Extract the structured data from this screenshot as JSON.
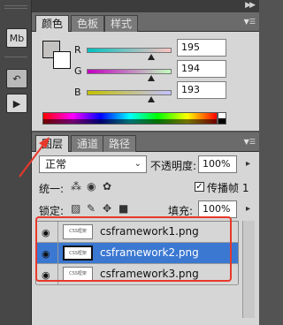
{
  "toolstrip": {
    "buttons": [
      {
        "icon": "mini-bridge-icon",
        "glyph": "Mb"
      },
      {
        "icon": "history-icon",
        "glyph": "↶"
      },
      {
        "icon": "actions-play-icon",
        "glyph": "▶"
      }
    ]
  },
  "color_panel": {
    "tabs": [
      "颜色",
      "色板",
      "样式"
    ],
    "active_tab": "颜色",
    "foreground_color": "#ffffff",
    "background_color": "#c3c2c1",
    "channels": [
      {
        "label": "R",
        "value": "195",
        "fraction": 0.765
      },
      {
        "label": "G",
        "value": "194",
        "fraction": 0.761
      },
      {
        "label": "B",
        "value": "193",
        "fraction": 0.757
      }
    ]
  },
  "layers_panel": {
    "tabs": [
      "图层",
      "通道",
      "路径"
    ],
    "active_tab": "图层",
    "blend_mode": "正常",
    "opacity_label": "不透明度:",
    "opacity_value": "100%",
    "unify_label": "统一:",
    "propagate_label": "传播帧 1",
    "propagate_checked": "✓",
    "lock_label": "锁定:",
    "fill_label": "填充:",
    "fill_value": "100%",
    "thumb_text": "CSS框架",
    "layers": [
      {
        "name": "csframework1.png",
        "selected": false
      },
      {
        "name": "csframework2.png",
        "selected": true
      },
      {
        "name": "csframework3.png",
        "selected": false
      }
    ]
  },
  "colors": {
    "selection": "#3b78d2",
    "highlight": "#e8382a",
    "panel_bg": "#d6d6d6"
  }
}
